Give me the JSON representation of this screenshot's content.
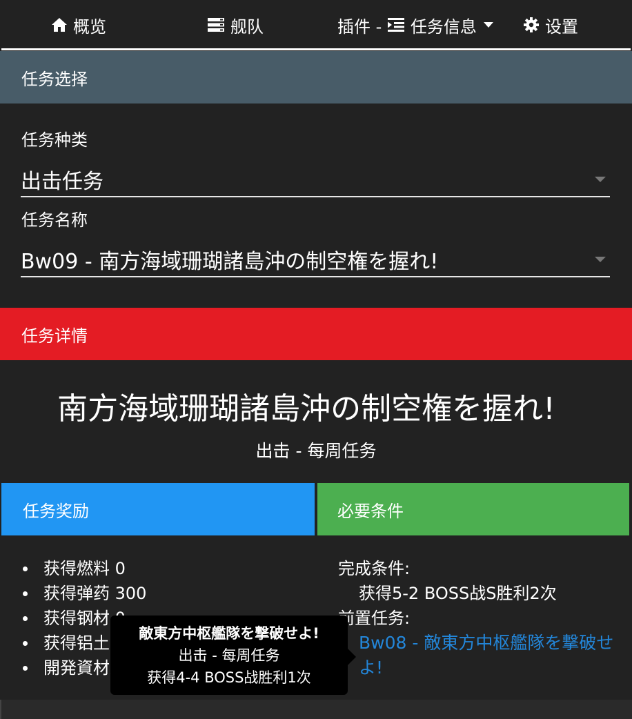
{
  "nav": {
    "overview": {
      "label": "概览",
      "icon": "home-icon"
    },
    "fleet": {
      "label": "舰队",
      "icon": "server-icon"
    },
    "plugins": {
      "prefix": "插件 - ",
      "label": "任务信息",
      "icon": "indent-list-icon"
    },
    "settings": {
      "label": "设置",
      "icon": "gear-icon"
    }
  },
  "quest_select": {
    "header": "任务选择",
    "category_label": "任务种类",
    "category_value": "出击任务",
    "name_label": "任务名称",
    "name_value": "Bw09 - 南方海域珊瑚諸島沖の制空権を握れ!"
  },
  "quest_detail": {
    "header": "任务详情",
    "title": "南方海域珊瑚諸島沖の制空権を握れ!",
    "subtitle": "出击 - 每周任务"
  },
  "rewards": {
    "header": "任务奖励",
    "items": [
      "获得燃料 0",
      "获得弹药 300",
      "获得钢材 0",
      "获得铝土 800",
      "開発資材x2、改修資材x"
    ]
  },
  "requirements": {
    "header": "必要条件",
    "complete_label": "完成条件:",
    "complete_value": "获得5-2 BOSS战S胜利2次",
    "prereq_label": "前置任务:",
    "prereq_link": "Bw08 - 敵東方中枢艦隊を撃破せよ!"
  },
  "tooltip": {
    "title": "敵東方中枢艦隊を撃破せよ!",
    "type": "出击 - 每周任务",
    "condition": "获得4-4 BOSS战胜利1次"
  },
  "colors": {
    "background": "#222222",
    "select_header": "#485c68",
    "detail_header": "#e41c24",
    "reward_header": "#2196f3",
    "requirement_header": "#4caf50",
    "link": "#2386d9"
  }
}
